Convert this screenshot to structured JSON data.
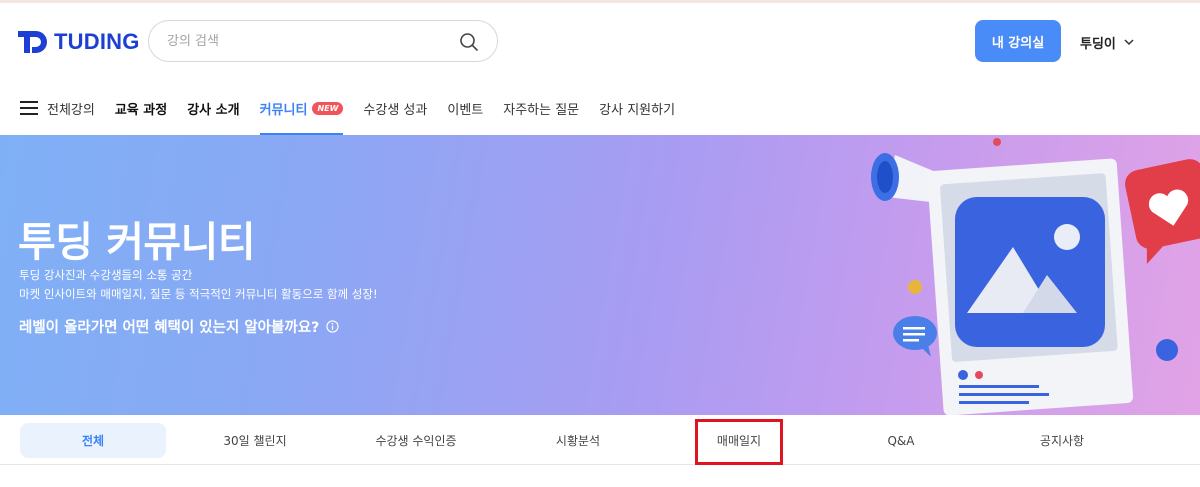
{
  "header": {
    "logo_text": "TUDING",
    "search_placeholder": "강의 검색",
    "my_class_label": "내 강의실",
    "user_name": "투딩이"
  },
  "nav": {
    "items": [
      {
        "label": "전체강의"
      },
      {
        "label": "교육 과정"
      },
      {
        "label": "강사 소개"
      },
      {
        "label": "커뮤니티",
        "badge": "NEW"
      },
      {
        "label": "수강생 성과"
      },
      {
        "label": "이벤트"
      },
      {
        "label": "자주하는 질문"
      },
      {
        "label": "강사 지원하기"
      }
    ]
  },
  "banner": {
    "title": "투딩 커뮤니티",
    "desc_line1": "투딩 강사진과 수강생들의 소통 공간",
    "desc_line2": "마켓 인사이트와 매매일지, 질문 등 적극적인 커뮤니티 활동으로 함께 성장!",
    "level_link": "레벨이 올라가면 어떤 혜택이 있는지 알아볼까요?"
  },
  "tabs": [
    {
      "label": "전체"
    },
    {
      "label": "30일 챌린지"
    },
    {
      "label": "수강생 수익인증"
    },
    {
      "label": "시황분석"
    },
    {
      "label": "매매일지"
    },
    {
      "label": "Q&A"
    },
    {
      "label": "공지사항"
    }
  ],
  "colors": {
    "brand": "#1d3fd3",
    "accent": "#4a8cf7",
    "badge": "#f2545b",
    "highlight": "#e0141e"
  }
}
